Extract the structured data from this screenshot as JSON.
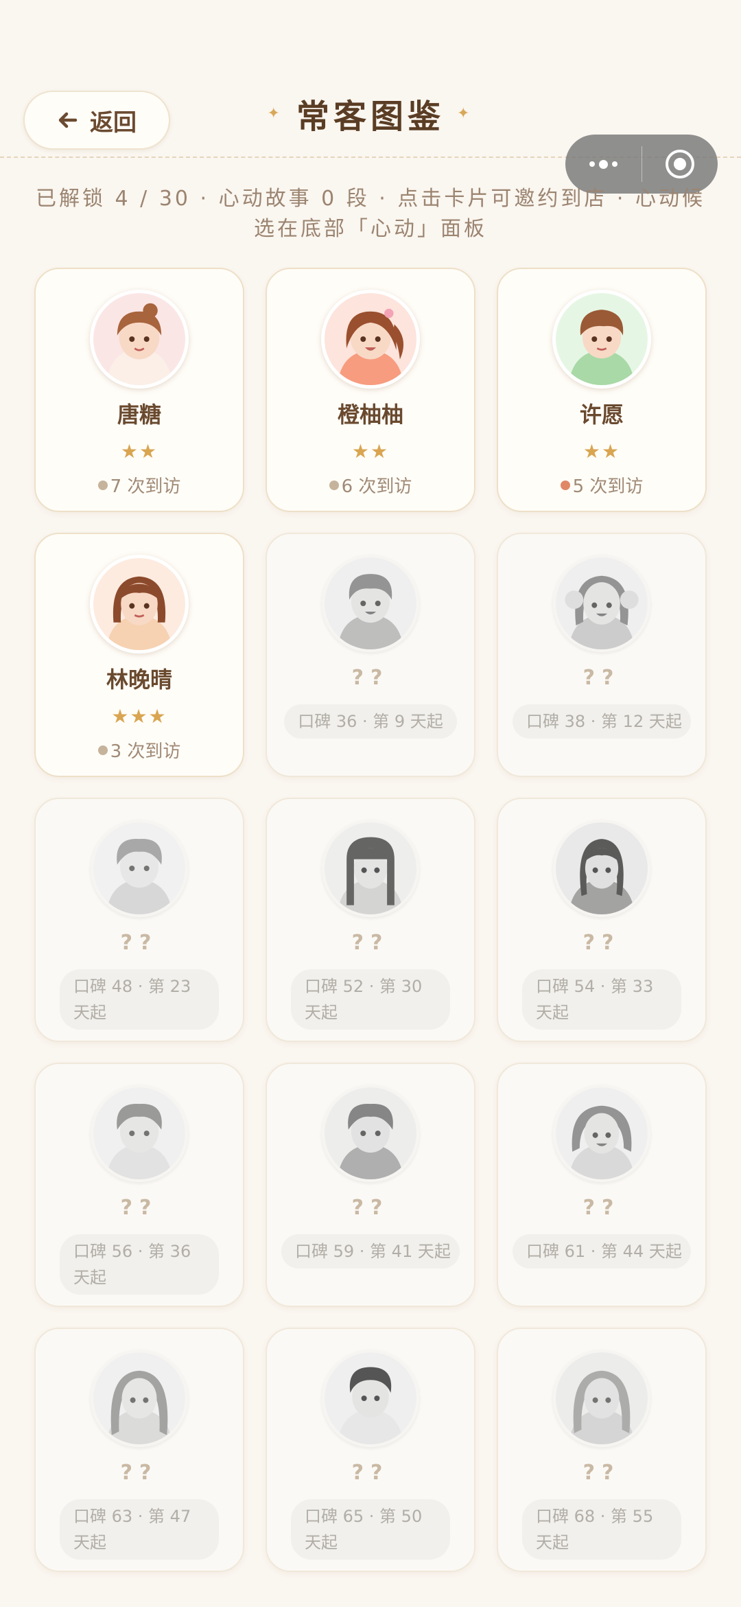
{
  "header": {
    "back_label": "返回",
    "title": "常客图鉴",
    "subtitle": "已解锁 4 / 30 · 心动故事 0 段 · 点击卡片可邀约到店 · 心动候选在底部「心动」面板"
  },
  "colors": {
    "background": "#faf6f0",
    "accent_brown": "#6a4a2f",
    "star_gold": "#d9a551",
    "hot_dot": "#e08866"
  },
  "unlocked": [
    {
      "name": "唐糖",
      "stars": "★★",
      "visits": "7 次到访",
      "dot": "normal"
    },
    {
      "name": "橙柚柚",
      "stars": "★★",
      "visits": "6 次到访",
      "dot": "normal"
    },
    {
      "name": "许愿",
      "stars": "★★",
      "visits": "5 次到访",
      "dot": "hot"
    },
    {
      "name": "林晚晴",
      "stars": "★★★",
      "visits": "3 次到访",
      "dot": "normal"
    }
  ],
  "locked": [
    {
      "name": "??",
      "hint": "口碑 36 · 第 9 天起"
    },
    {
      "name": "??",
      "hint": "口碑 38 · 第 12 天起"
    },
    {
      "name": "??",
      "hint": "口碑 48 · 第 23 天起"
    },
    {
      "name": "??",
      "hint": "口碑 52 · 第 30 天起"
    },
    {
      "name": "??",
      "hint": "口碑 54 · 第 33 天起"
    },
    {
      "name": "??",
      "hint": "口碑 56 · 第 36 天起"
    },
    {
      "name": "??",
      "hint": "口碑 59 · 第 41 天起"
    },
    {
      "name": "??",
      "hint": "口碑 61 · 第 44 天起"
    },
    {
      "name": "??",
      "hint": "口碑 63 · 第 47 天起"
    },
    {
      "name": "??",
      "hint": "口碑 65 · 第 50 天起"
    },
    {
      "name": "??",
      "hint": "口碑 68 · 第 55 天起"
    }
  ]
}
